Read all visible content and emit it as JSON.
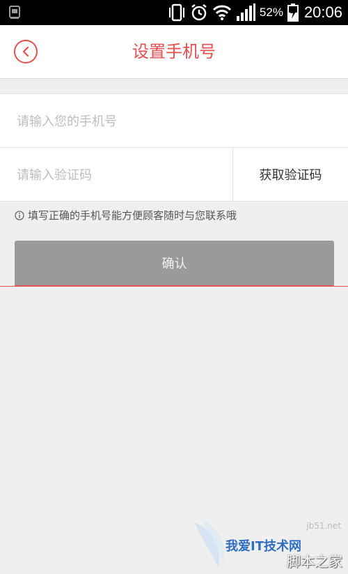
{
  "status_bar": {
    "battery_percent": "52%",
    "time": "20:06",
    "icons": [
      "sim-icon",
      "vibrate-icon",
      "alarm-icon",
      "wifi-icon",
      "signal-icon",
      "battery-charging-icon"
    ]
  },
  "header": {
    "title": "设置手机号",
    "back_icon": "back-arrow-icon"
  },
  "form": {
    "phone_placeholder": "请输入您的手机号",
    "phone_value": "",
    "code_placeholder": "请输入验证码",
    "code_value": "",
    "get_code_label": "获取验证码"
  },
  "hint": {
    "icon": "info-icon",
    "text": "填写正确的手机号能方便顾客随时与您联系哦"
  },
  "confirm_label": "确认",
  "colors": {
    "accent": "#e84e4e",
    "button_disabled": "#9a9a9a",
    "background": "#efefef"
  },
  "watermark": {
    "main": "我爱IT技术网",
    "site": "jb51.net",
    "sub": "脚本之家"
  }
}
